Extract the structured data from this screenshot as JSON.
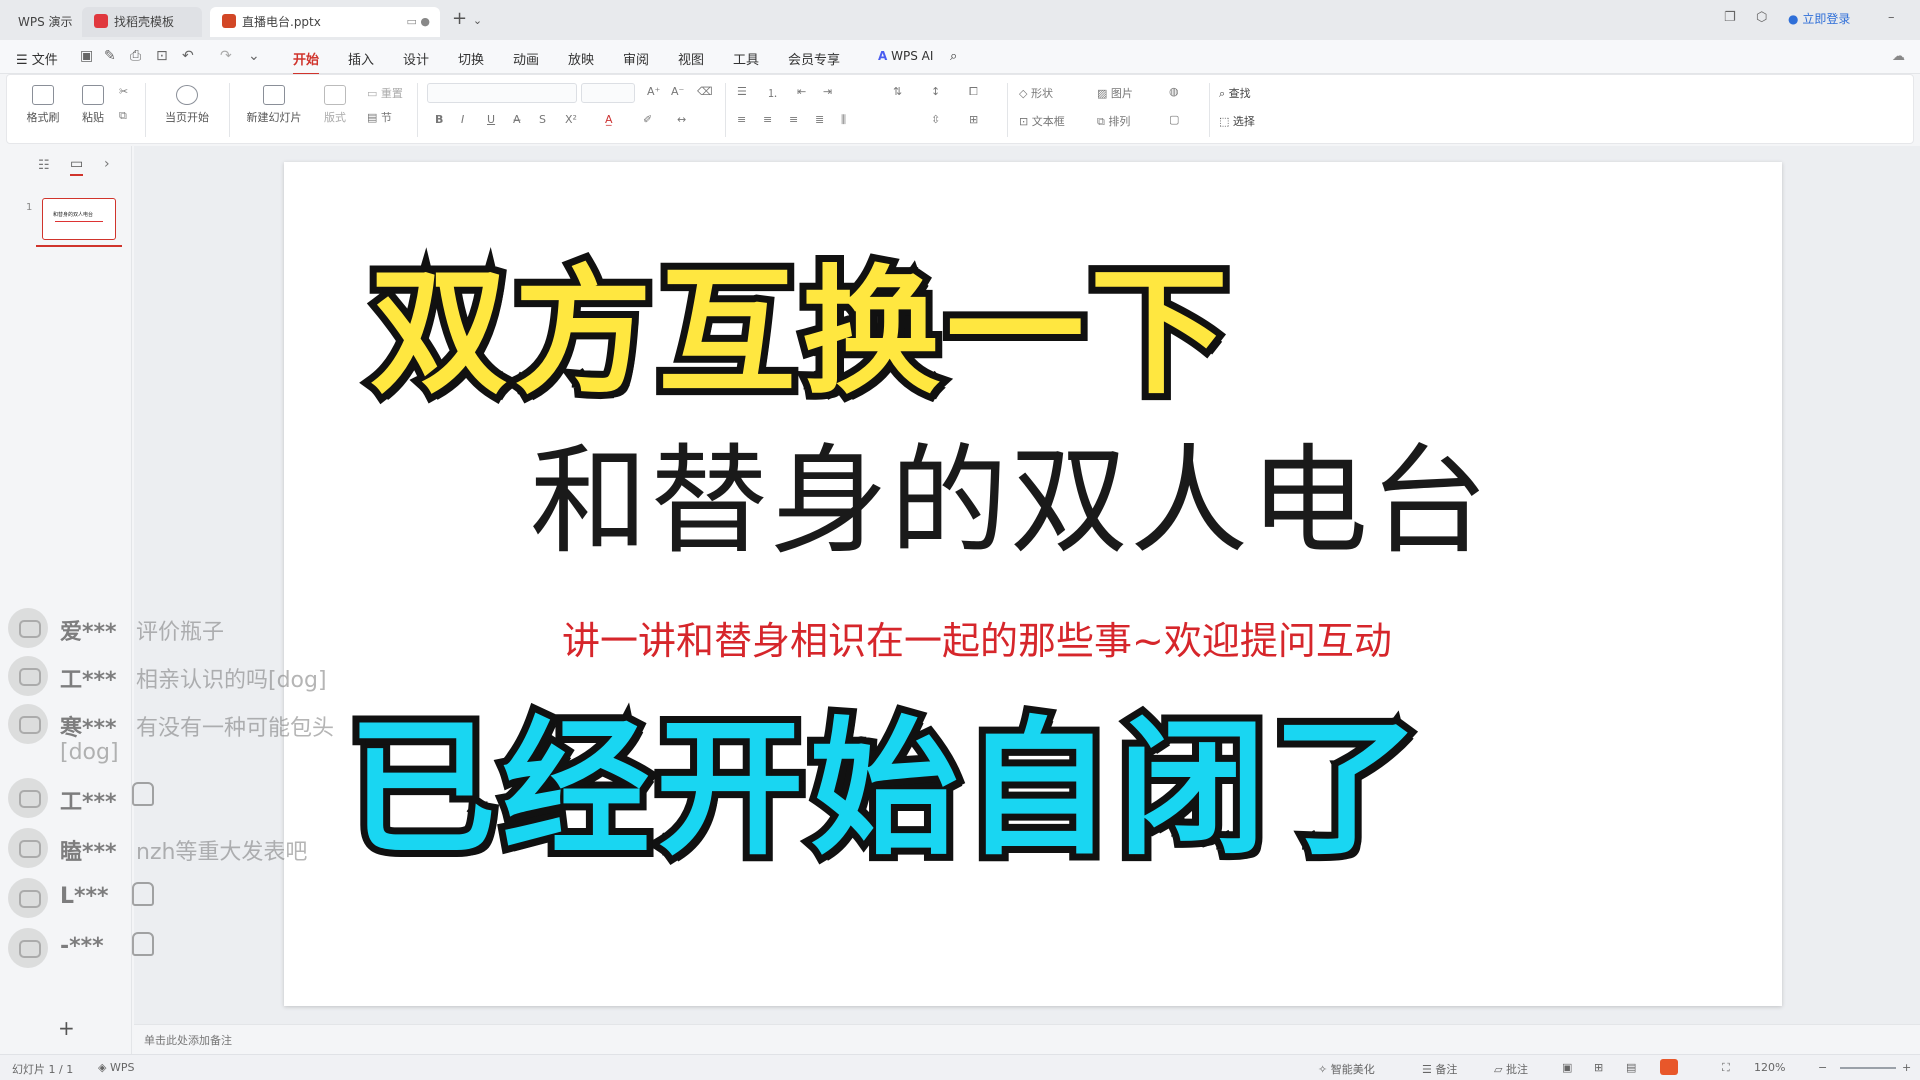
{
  "titlebar": {
    "app_tab": "WPS 演示",
    "template_tab": "找稻壳模板",
    "doc_tab": "直播电台.pptx",
    "new_tab": "+",
    "login": "立即登录"
  },
  "menu": {
    "file": "文件",
    "items": [
      "开始",
      "插入",
      "设计",
      "切换",
      "动画",
      "放映",
      "审阅",
      "视图",
      "工具",
      "会员专享"
    ],
    "wps_ai": "WPS AI"
  },
  "ribbon": {
    "format_painter": "格式刷",
    "paste": "粘贴",
    "play_from_current": "当页开始",
    "new_slide": "新建幻灯片",
    "layout": "版式",
    "section": "节",
    "reset": "重置",
    "shape": "形状",
    "picture": "图片",
    "textbox": "文本框",
    "arrange": "排列",
    "find": "查找",
    "select": "选择",
    "bold": "B",
    "italic": "I",
    "underline": "U",
    "strike": "S"
  },
  "thumbnails": {
    "slide_number": "1",
    "thumb_text": "和替身的双人电台"
  },
  "slide": {
    "caption_top": "双方互换一下",
    "title": "和替身的双人电台",
    "subtitle": "讲一讲和替身相识在一起的那些事~欢迎提问互动",
    "caption_bottom": "已经开始自闭了"
  },
  "chat": [
    {
      "name": "爱***",
      "text": "评价瓶子"
    },
    {
      "name": "工***",
      "text": "相亲认识的吗[dog]"
    },
    {
      "name": "寒***",
      "text": "有没有一种可能包头",
      "text2": "[dog]"
    },
    {
      "name": "工***",
      "text": "",
      "emoji": "dog-emoji-icon"
    },
    {
      "name": "瞌***",
      "text": "nzh等重大发表吧"
    },
    {
      "name": "L***",
      "text": "",
      "emoji": "dog-emoji-icon"
    },
    {
      "name": "-***",
      "text": "",
      "emoji": "dog-emoji-icon"
    }
  ],
  "notes": {
    "placeholder": "单击此处添加备注",
    "add": "+"
  },
  "status": {
    "slide_counter": "幻灯片 1 / 1",
    "theme": "WPS",
    "smart_beautify": "智能美化",
    "notes": "备注",
    "comments": "批注",
    "zoom": "120%"
  },
  "colors": {
    "accent": "#d0342c",
    "caption_yellow": "#ffe740",
    "caption_cyan": "#19d6f2",
    "subtitle_red": "#d6262b"
  }
}
